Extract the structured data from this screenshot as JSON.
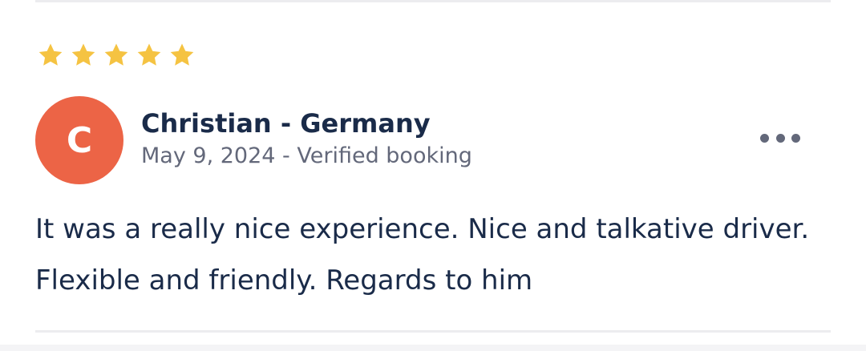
{
  "review": {
    "rating": 5,
    "max_rating": 5,
    "star_color": "#f5c342",
    "avatar_initial": "C",
    "avatar_color": "#ec6446",
    "reviewer": "Christian - Germany",
    "meta": "May 9, 2024 - Verified booking",
    "text": "It was a really nice experience. Nice and talkative driver. Flexible and friendly. Regards to him",
    "more_icon": "more-horizontal-icon"
  }
}
